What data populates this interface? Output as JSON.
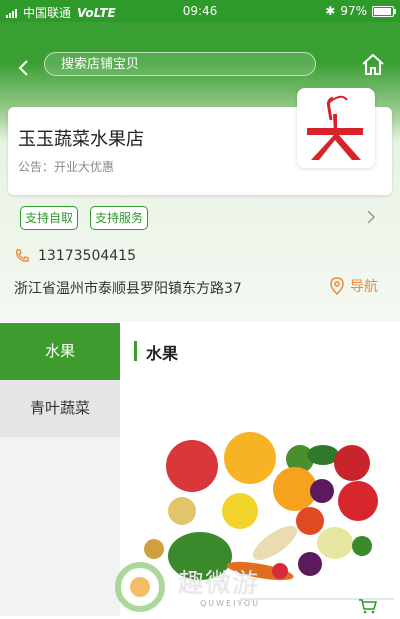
{
  "status_bar": {
    "carrier": "中国联通",
    "network": "VoLTE",
    "time": "09:46",
    "battery": "97%",
    "battery_level": 0.97
  },
  "header": {
    "search_placeholder": "搜索店铺宝贝"
  },
  "shop": {
    "name": "玉玉蔬菜水果店",
    "notice": "公告：开业大优惠",
    "tags": [
      "支持自取",
      "支持服务"
    ],
    "phone": "13173504415",
    "address": "浙江省温州市泰顺县罗阳镇东方路37",
    "navigate_label": "导航"
  },
  "categories": [
    {
      "label": "水果"
    },
    {
      "label": "青叶蔬菜"
    }
  ],
  "section": {
    "title": "水果"
  },
  "colors": {
    "brand_green": "#2e9a2a",
    "accent_orange": "#f08a3a",
    "logo_red": "#d9232a"
  }
}
